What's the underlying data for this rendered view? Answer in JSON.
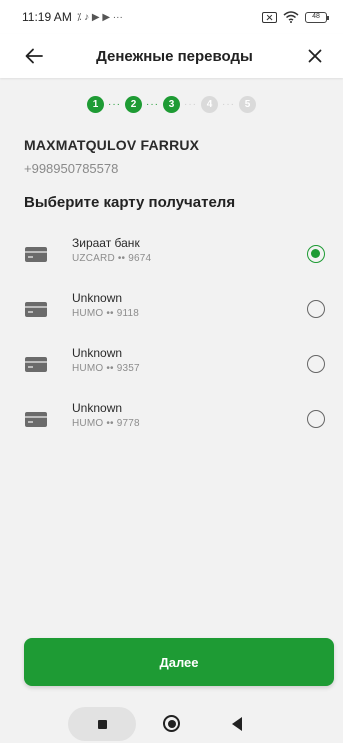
{
  "status_bar": {
    "time": "11:19 AM",
    "icons": "⁒ ♪ ▶ ▶ ···",
    "battery": "48"
  },
  "header": {
    "title": "Денежные переводы",
    "back_icon": "arrow-left",
    "close_icon": "close"
  },
  "stepper": {
    "steps": [
      "1",
      "2",
      "3",
      "4",
      "5"
    ],
    "completed": 3
  },
  "recipient": {
    "name": "MAXMATQULOV FARRUX",
    "phone": "+998950785578"
  },
  "section_title": "Выберите карту получателя",
  "cards": [
    {
      "name": "Зираат банк",
      "number": "UZCARD •• 9674",
      "selected": true
    },
    {
      "name": "Unknown",
      "number": "HUMO •• 9118",
      "selected": false
    },
    {
      "name": "Unknown",
      "number": "HUMO •• 9357",
      "selected": false
    },
    {
      "name": "Unknown",
      "number": "HUMO •• 9778",
      "selected": false
    }
  ],
  "next_button": "Далее",
  "colors": {
    "accent": "#1e9b34",
    "background": "#f2f2f2",
    "step_inactive": "#dadada"
  }
}
